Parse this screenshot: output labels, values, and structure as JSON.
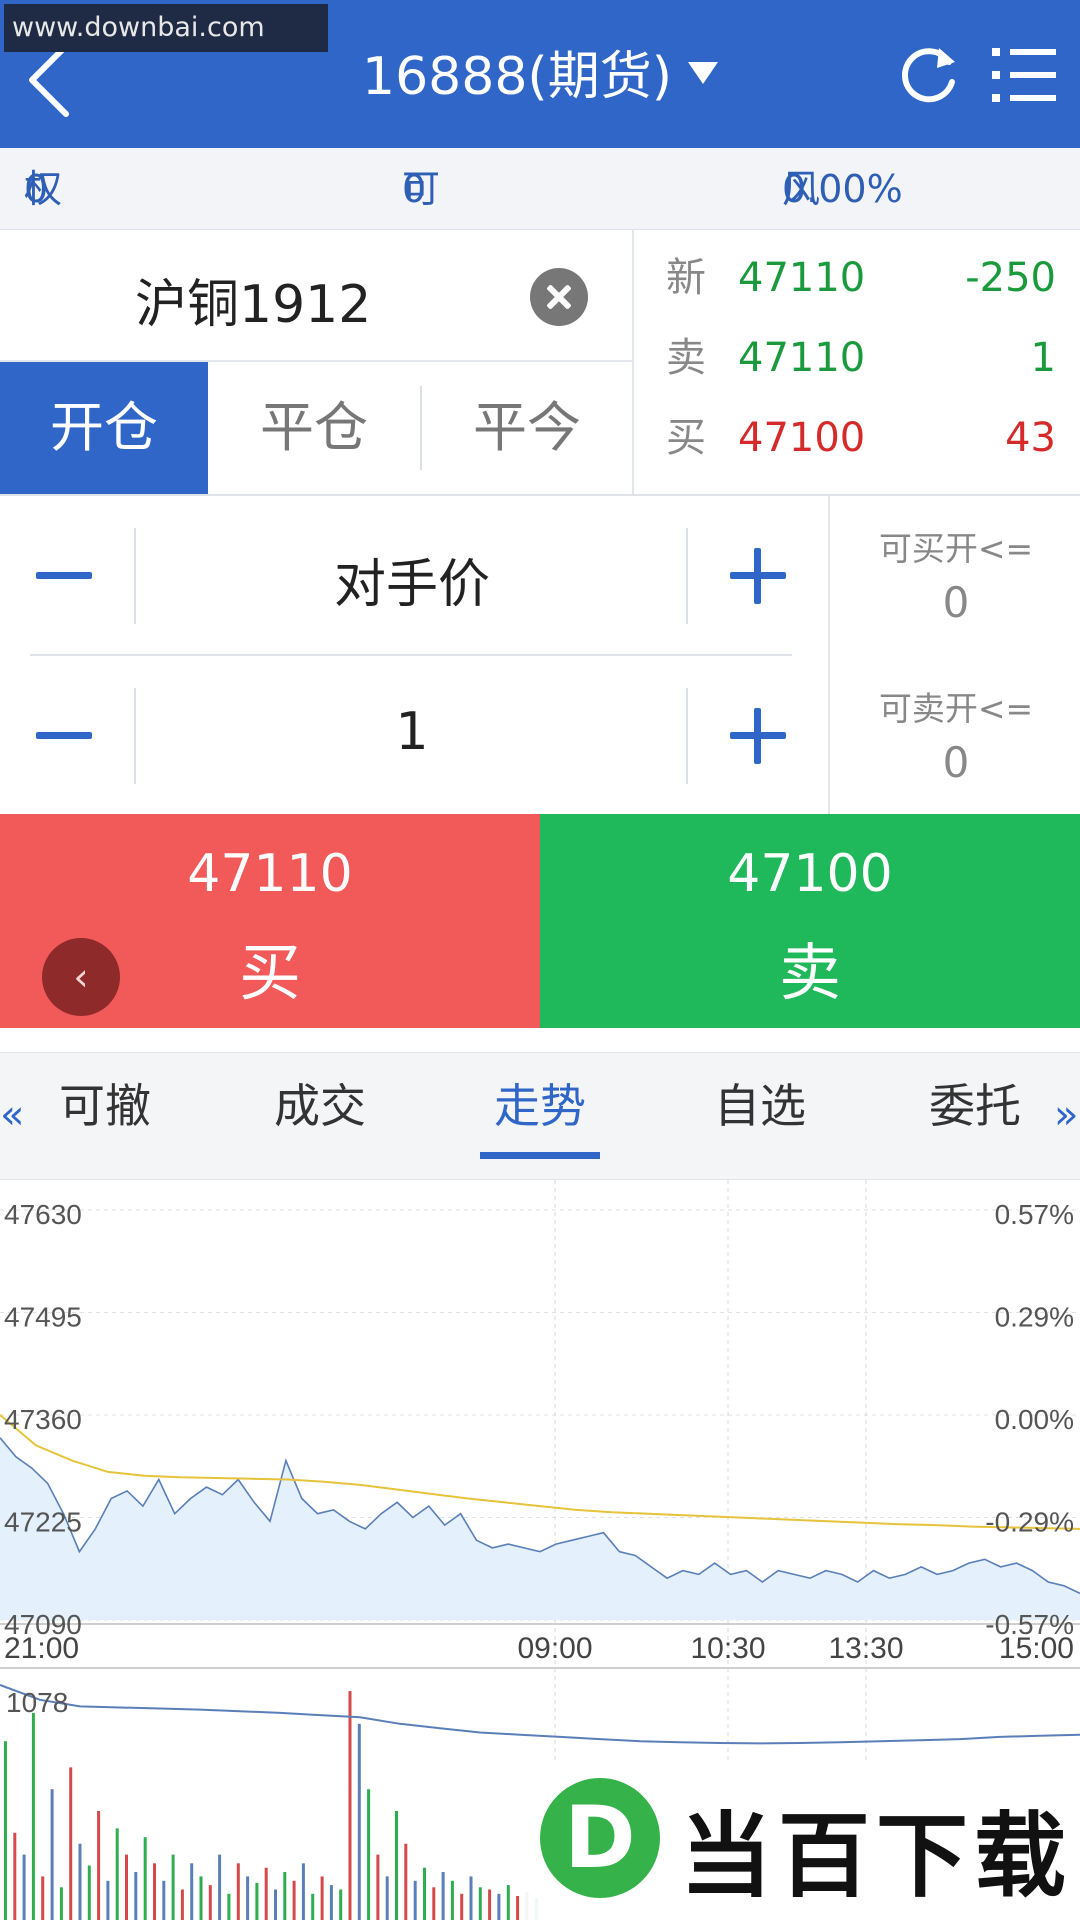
{
  "watermark": {
    "text": "www.downbai.com"
  },
  "header": {
    "title": "16888(期货)"
  },
  "account": {
    "equity_label": "权益:",
    "equity_value": "0",
    "available_label": "可用:",
    "available_value": "0",
    "risk_label": "风险度:",
    "risk_value": "0.00%"
  },
  "contract": {
    "name": "沪铜1912"
  },
  "position_tabs": [
    {
      "label": "开仓",
      "active": true
    },
    {
      "label": "平仓",
      "active": false
    },
    {
      "label": "平今",
      "active": false
    }
  ],
  "quotes": [
    {
      "label": "新",
      "price": "47110",
      "volume": "-250",
      "price_color": "green",
      "volume_color": "green"
    },
    {
      "label": "卖",
      "price": "47110",
      "volume": "1",
      "price_color": "green",
      "volume_color": "green"
    },
    {
      "label": "买",
      "price": "47100",
      "volume": "43",
      "price_color": "red",
      "volume_color": "red"
    }
  ],
  "order": {
    "price_type": "对手价",
    "quantity": "1"
  },
  "available": {
    "buy_open_label": "可买开<=",
    "buy_open_value": "0",
    "sell_open_label": "可卖开<=",
    "sell_open_value": "0"
  },
  "buy_button": {
    "price": "47110",
    "label": "买"
  },
  "sell_button": {
    "price": "47100",
    "label": "卖"
  },
  "float_back": {
    "symbol": "‹"
  },
  "bottom_tabs": [
    {
      "label": "可撤",
      "active": false
    },
    {
      "label": "成交",
      "active": false
    },
    {
      "label": "走势",
      "active": true
    },
    {
      "label": "自选",
      "active": false
    },
    {
      "label": "委托",
      "active": false
    }
  ],
  "nav": {
    "left": "«",
    "right": "»"
  },
  "chart_data": {
    "type": "line",
    "y_ticks": [
      "47630",
      "47495",
      "47360",
      "47225",
      "47090"
    ],
    "y_pct_ticks": [
      "0.57%",
      "0.29%",
      "0.00%",
      "-0.29%",
      "-0.57%"
    ],
    "x_ticks": [
      "21:00",
      "09:00",
      "10:30",
      "13:30",
      "15:00"
    ],
    "ylim": [
      47090,
      47630
    ],
    "price_series": [
      47330,
      47305,
      47290,
      47270,
      47230,
      47180,
      47210,
      47250,
      47260,
      47240,
      47275,
      47230,
      47250,
      47265,
      47255,
      47275,
      47245,
      47220,
      47300,
      47250,
      47230,
      47235,
      47220,
      47210,
      47230,
      47245,
      47225,
      47240,
      47215,
      47230,
      47195,
      47185,
      47190,
      47185,
      47180,
      47190,
      47195,
      47200,
      47205,
      47180,
      47175,
      47160,
      47145,
      47155,
      47150,
      47165,
      47150,
      47155,
      47140,
      47155,
      47150,
      47145,
      47155,
      47150,
      47140,
      47155,
      47145,
      47150,
      47160,
      47150,
      47155,
      47165,
      47170,
      47160,
      47165,
      47155,
      47140,
      47135,
      47125
    ],
    "avg_series": [
      47360,
      47320,
      47300,
      47285,
      47280,
      47278,
      47277,
      47276,
      47275,
      47272,
      47268,
      47262,
      47256,
      47250,
      47245,
      47240,
      47235,
      47232,
      47230,
      47228,
      47226,
      47224,
      47222,
      47220,
      47218,
      47216,
      47215,
      47213,
      47212,
      47211,
      47210
    ],
    "volume_label": "1078",
    "volume_ylim": [
      0,
      1078
    ],
    "volume_bars": [
      820,
      400,
      300,
      950,
      200,
      600,
      150,
      700,
      350,
      250,
      500,
      180,
      420,
      300,
      220,
      380,
      260,
      180,
      300,
      140,
      260,
      200,
      160,
      300,
      120,
      260,
      200,
      170,
      240,
      140,
      220,
      180,
      260,
      120,
      200,
      160,
      140,
      1050,
      900,
      600,
      300,
      200,
      500,
      350,
      180,
      240,
      150,
      220,
      180,
      120,
      200,
      150,
      140,
      120,
      160,
      110,
      130,
      100
    ],
    "volume_avg": [
      1078,
      1010,
      980,
      975,
      970,
      965,
      958,
      950,
      940,
      930,
      900,
      880,
      860,
      850,
      840,
      830,
      820,
      815,
      812,
      810,
      812,
      815,
      820,
      825,
      830,
      840,
      845,
      850
    ]
  }
}
